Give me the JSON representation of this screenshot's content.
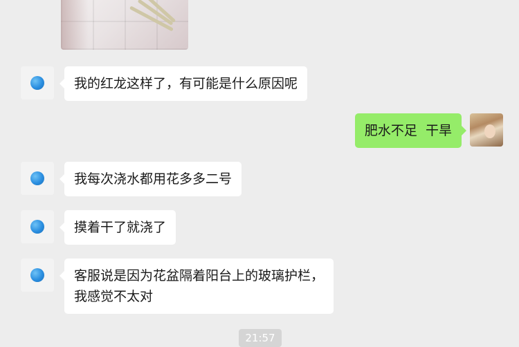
{
  "messages": [
    {
      "side": "left",
      "text": "我的红龙这样了，有可能是什么原因呢"
    },
    {
      "side": "right",
      "text": "肥水不足  干旱"
    },
    {
      "side": "left",
      "text": "我每次浇水都用花多多二号"
    },
    {
      "side": "left",
      "text": "摸着干了就浇了"
    },
    {
      "side": "left",
      "lines": [
        "客服说是因为花盆隔着阳台上的玻璃护栏，",
        "我感觉不太对"
      ]
    }
  ],
  "timestamp": "21:57",
  "colors": {
    "background": "#ededed",
    "incoming_bubble": "#ffffff",
    "outgoing_bubble": "#95ec69"
  },
  "icons": {
    "contact_avatar": "blue-dot-avatar-icon",
    "user_avatar": "portrait-avatar-icon"
  }
}
